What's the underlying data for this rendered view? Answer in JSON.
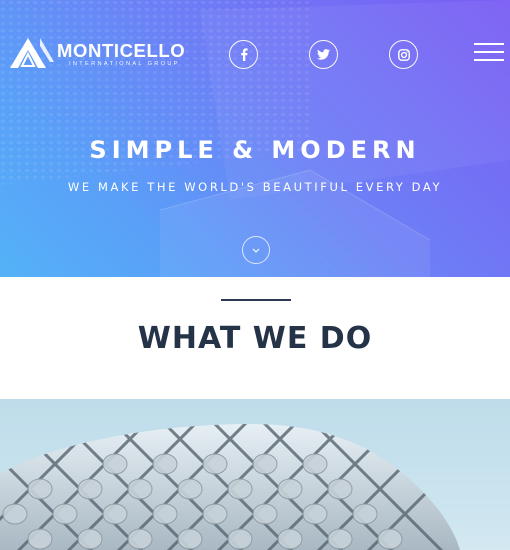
{
  "brand": {
    "name": "MONTICELLO",
    "tagline": "INTERNATIONAL GROUP"
  },
  "social": [
    {
      "name": "facebook",
      "icon": "facebook-icon"
    },
    {
      "name": "twitter",
      "icon": "twitter-icon"
    },
    {
      "name": "instagram",
      "icon": "instagram-icon"
    }
  ],
  "nav": {
    "icon": "hamburger-menu-icon"
  },
  "hero": {
    "title": "SIMPLE & MODERN",
    "subtitle": "WE MAKE THE WORLD'S BEAUTIFUL EVERY DAY",
    "scroll_icon": "chevron-down-icon"
  },
  "section": {
    "title": "WHAT WE DO"
  },
  "colors": {
    "hero_gradient_start": "#7a5cf4",
    "hero_gradient_end": "#54b2f7",
    "heading": "#243348",
    "rule": "#2b3a52"
  }
}
